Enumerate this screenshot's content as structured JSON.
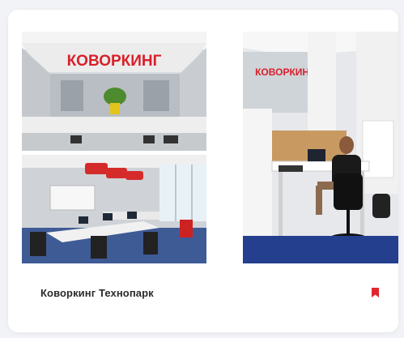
{
  "card": {
    "title": "Коворкинг Технопарк",
    "bookmark_icon": "bookmark-icon",
    "accent_color": "#e3262e"
  },
  "photos": [
    {
      "name": "photo-coworking-entrance",
      "sign_text": "КОВОРКИНГ"
    },
    {
      "name": "photo-coworking-desks"
    },
    {
      "name": "photo-coworking-workstation",
      "sign_text": "КОВОРКИНГ"
    }
  ]
}
